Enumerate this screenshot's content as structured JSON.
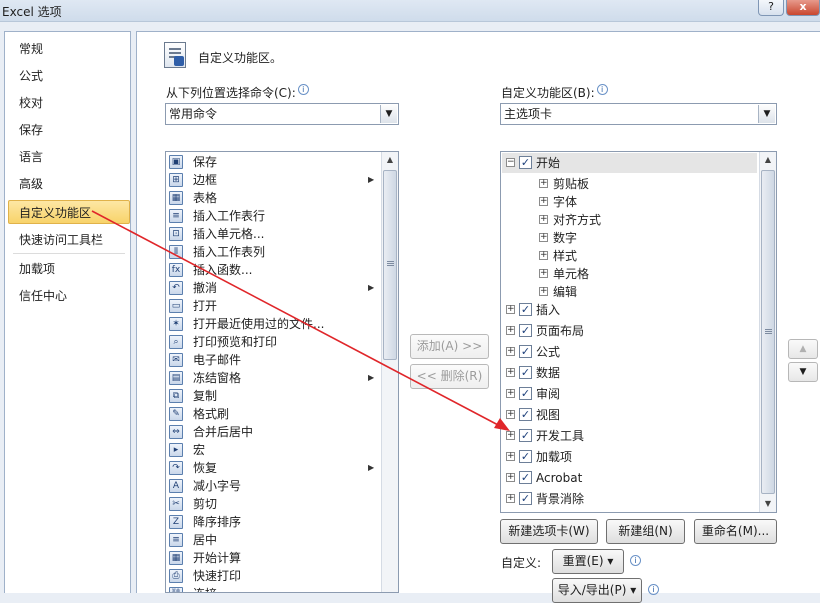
{
  "window": {
    "title": "Excel 选项",
    "help_label": "?",
    "close_label": "x"
  },
  "nav": {
    "items": [
      {
        "label": "常规",
        "selected": false
      },
      {
        "label": "公式",
        "selected": false
      },
      {
        "label": "校对",
        "selected": false
      },
      {
        "label": "保存",
        "selected": false
      },
      {
        "label": "语言",
        "selected": false
      },
      {
        "label": "高级",
        "selected": false
      },
      {
        "label": "自定义功能区",
        "selected": true
      },
      {
        "label": "快速访问工具栏",
        "selected": false
      },
      {
        "label": "加载项",
        "selected": false
      },
      {
        "label": "信任中心",
        "selected": false
      }
    ]
  },
  "header": {
    "title": "自定义功能区。"
  },
  "left_panel": {
    "label": "从下列位置选择命令(C):",
    "dropdown_value": "常用命令",
    "commands": [
      {
        "label": "保存",
        "icon": "save-icon",
        "glyph": "▣"
      },
      {
        "label": "边框",
        "icon": "border-icon",
        "glyph": "⊞"
      },
      {
        "label": "表格",
        "icon": "table-icon",
        "glyph": "▦"
      },
      {
        "label": "插入工作表行",
        "icon": "insert-row-icon",
        "glyph": "≡"
      },
      {
        "label": "插入单元格...",
        "icon": "insert-cells-icon",
        "glyph": "⊡"
      },
      {
        "label": "插入工作表列",
        "icon": "insert-column-icon",
        "glyph": "⫴"
      },
      {
        "label": "插入函数...",
        "icon": "function-icon",
        "glyph": "fx"
      },
      {
        "label": "撤消",
        "icon": "undo-icon",
        "glyph": "↶"
      },
      {
        "label": "打开",
        "icon": "open-folder-icon",
        "glyph": "▭"
      },
      {
        "label": "打开最近使用过的文件...",
        "icon": "recent-files-icon",
        "glyph": "✶"
      },
      {
        "label": "打印预览和打印",
        "icon": "print-preview-icon",
        "glyph": "⌕"
      },
      {
        "label": "电子邮件",
        "icon": "email-icon",
        "glyph": "✉"
      },
      {
        "label": "冻结窗格",
        "icon": "freeze-panes-icon",
        "glyph": "▤"
      },
      {
        "label": "复制",
        "icon": "copy-icon",
        "glyph": "⧉"
      },
      {
        "label": "格式刷",
        "icon": "format-painter-icon",
        "glyph": "✎"
      },
      {
        "label": "合并后居中",
        "icon": "merge-center-icon",
        "glyph": "⇔"
      },
      {
        "label": "宏",
        "icon": "macro-icon",
        "glyph": "▸"
      },
      {
        "label": "恢复",
        "icon": "redo-icon",
        "glyph": "↷"
      },
      {
        "label": "减小字号",
        "icon": "decrease-font-icon",
        "glyph": "A"
      },
      {
        "label": "剪切",
        "icon": "cut-icon",
        "glyph": "✂"
      },
      {
        "label": "降序排序",
        "icon": "sort-desc-icon",
        "glyph": "Z"
      },
      {
        "label": "居中",
        "icon": "align-center-icon",
        "glyph": "≡"
      },
      {
        "label": "开始计算",
        "icon": "calculate-icon",
        "glyph": "▦"
      },
      {
        "label": "快速打印",
        "icon": "quick-print-icon",
        "glyph": "⎙"
      },
      {
        "label": "连接",
        "icon": "connections-icon",
        "glyph": "⛓"
      }
    ]
  },
  "middle": {
    "add_label": "添加(A) >>",
    "remove_label": "<< 删除(R)"
  },
  "right_panel": {
    "label": "自定义功能区(B):",
    "dropdown_value": "主选项卡",
    "tabs": [
      {
        "label": "开始",
        "level": 0,
        "checked": true,
        "expander": "−",
        "selected": true
      },
      {
        "label": "剪贴板",
        "level": 1,
        "expander": "+"
      },
      {
        "label": "字体",
        "level": 1,
        "expander": "+"
      },
      {
        "label": "对齐方式",
        "level": 1,
        "expander": "+"
      },
      {
        "label": "数字",
        "level": 1,
        "expander": "+"
      },
      {
        "label": "样式",
        "level": 1,
        "expander": "+"
      },
      {
        "label": "单元格",
        "level": 1,
        "expander": "+"
      },
      {
        "label": "编辑",
        "level": 1,
        "expander": "+"
      },
      {
        "label": "插入",
        "level": 0,
        "checked": true,
        "expander": "+"
      },
      {
        "label": "页面布局",
        "level": 0,
        "checked": true,
        "expander": "+"
      },
      {
        "label": "公式",
        "level": 0,
        "checked": true,
        "expander": "+"
      },
      {
        "label": "数据",
        "level": 0,
        "checked": true,
        "expander": "+"
      },
      {
        "label": "审阅",
        "level": 0,
        "checked": true,
        "expander": "+"
      },
      {
        "label": "视图",
        "level": 0,
        "checked": true,
        "expander": "+"
      },
      {
        "label": "开发工具",
        "level": 0,
        "checked": true,
        "expander": "+"
      },
      {
        "label": "加载项",
        "level": 0,
        "checked": true,
        "expander": "+"
      },
      {
        "label": "Acrobat",
        "level": 0,
        "checked": true,
        "expander": "+"
      },
      {
        "label": "背景消除",
        "level": 0,
        "checked": true,
        "expander": "+"
      }
    ],
    "new_tab_label": "新建选项卡(W)",
    "new_group_label": "新建组(N)",
    "rename_label": "重命名(M)...",
    "customize_label": "自定义:",
    "reset_label": "重置(E) ▾",
    "import_export_label": "导入/导出(P) ▾"
  },
  "colors": {
    "accent_arrow": "#e0262a",
    "selection": "#f8d36a"
  }
}
